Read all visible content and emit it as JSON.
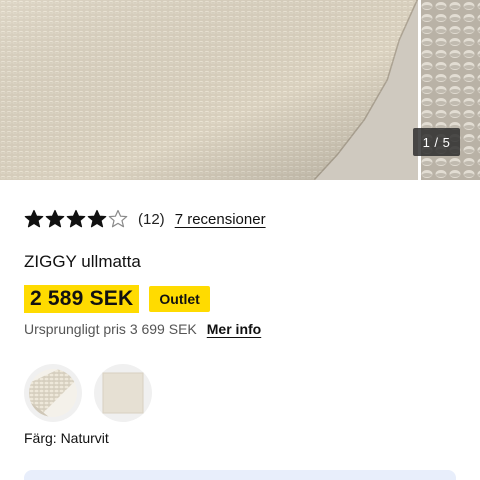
{
  "gallery": {
    "current": "1 / 5",
    "image": "product-photo-rug-closeup"
  },
  "rating": {
    "stars": 4,
    "max_stars": 5,
    "count": "(12)",
    "reviews_link": "7 recensioner",
    "star_color": "#111111"
  },
  "product": {
    "name": "ZIGGY ullmatta",
    "price": "2 589 SEK",
    "badge": "Outlet",
    "original_price": "Ursprungligt pris 3 699 SEK",
    "more_info": "Mer info",
    "highlight_color": "#ffdb00"
  },
  "swatches": [
    {
      "name": "swatch-natural-texture"
    },
    {
      "name": "swatch-natural-plain"
    }
  ],
  "color": {
    "label": "Färg: Naturvit"
  }
}
